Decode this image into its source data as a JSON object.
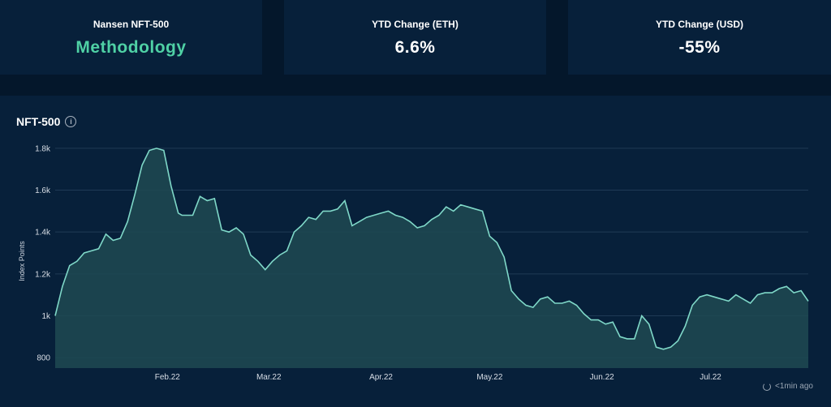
{
  "stats": [
    {
      "label": "Nansen NFT-500",
      "value": "Methodology"
    },
    {
      "label": "YTD Change (ETH)",
      "value": "6.6%"
    },
    {
      "label": "YTD Change (USD)",
      "value": "-55%"
    }
  ],
  "chart_title": "NFT-500",
  "updated": "<1min ago",
  "colors": {
    "line": "#7fd8c8",
    "fill": "#1e4a52",
    "grid": "#1f3a55"
  },
  "chart_data": {
    "type": "area",
    "title": "NFT-500",
    "xlabel": "",
    "ylabel": "Index Points",
    "ylim": [
      750,
      1850
    ],
    "yticks": [
      800,
      1000,
      1200,
      1400,
      1600,
      1800
    ],
    "ytick_labels": [
      "800",
      "1k",
      "1.2k",
      "1.4k",
      "1.6k",
      "1.8k"
    ],
    "xticks": [
      {
        "date": "2022-02-01",
        "label": "Feb.22"
      },
      {
        "date": "2022-03-01",
        "label": "Mar.22"
      },
      {
        "date": "2022-04-01",
        "label": "Apr.22"
      },
      {
        "date": "2022-05-01",
        "label": "May.22"
      },
      {
        "date": "2022-06-01",
        "label": "Jun.22"
      },
      {
        "date": "2022-07-01",
        "label": "Jul.22"
      }
    ],
    "x_range": [
      "2022-01-01",
      "2022-07-28"
    ],
    "grid": true,
    "series": [
      {
        "x": [
          "2022-01-01",
          "2022-01-03",
          "2022-01-05",
          "2022-01-07",
          "2022-01-09",
          "2022-01-11",
          "2022-01-13",
          "2022-01-15",
          "2022-01-17",
          "2022-01-19",
          "2022-01-21",
          "2022-01-23",
          "2022-01-25",
          "2022-01-27",
          "2022-01-29",
          "2022-01-31",
          "2022-02-02",
          "2022-02-04",
          "2022-02-05",
          "2022-02-07",
          "2022-02-08",
          "2022-02-10",
          "2022-02-12",
          "2022-02-14",
          "2022-02-16",
          "2022-02-18",
          "2022-02-20",
          "2022-02-22",
          "2022-02-24",
          "2022-02-26",
          "2022-02-28",
          "2022-03-02",
          "2022-03-04",
          "2022-03-06",
          "2022-03-08",
          "2022-03-10",
          "2022-03-12",
          "2022-03-14",
          "2022-03-16",
          "2022-03-18",
          "2022-03-20",
          "2022-03-22",
          "2022-03-24",
          "2022-03-26",
          "2022-03-28",
          "2022-03-30",
          "2022-04-01",
          "2022-04-03",
          "2022-04-05",
          "2022-04-07",
          "2022-04-09",
          "2022-04-11",
          "2022-04-13",
          "2022-04-15",
          "2022-04-17",
          "2022-04-19",
          "2022-04-21",
          "2022-04-23",
          "2022-04-25",
          "2022-04-27",
          "2022-04-29",
          "2022-05-01",
          "2022-05-03",
          "2022-05-05",
          "2022-05-07",
          "2022-05-09",
          "2022-05-11",
          "2022-05-13",
          "2022-05-15",
          "2022-05-17",
          "2022-05-19",
          "2022-05-21",
          "2022-05-23",
          "2022-05-25",
          "2022-05-27",
          "2022-05-29",
          "2022-05-31",
          "2022-06-02",
          "2022-06-04",
          "2022-06-06",
          "2022-06-08",
          "2022-06-10",
          "2022-06-12",
          "2022-06-14",
          "2022-06-16",
          "2022-06-18",
          "2022-06-20",
          "2022-06-22",
          "2022-06-24",
          "2022-06-26",
          "2022-06-28",
          "2022-06-30",
          "2022-07-02",
          "2022-07-04",
          "2022-07-06",
          "2022-07-08",
          "2022-07-10",
          "2022-07-12",
          "2022-07-14",
          "2022-07-16",
          "2022-07-18",
          "2022-07-20",
          "2022-07-22",
          "2022-07-24",
          "2022-07-26",
          "2022-07-28"
        ],
        "y": [
          1000,
          1140,
          1240,
          1260,
          1300,
          1310,
          1320,
          1390,
          1360,
          1370,
          1450,
          1580,
          1720,
          1790,
          1800,
          1790,
          1620,
          1490,
          1480,
          1480,
          1480,
          1570,
          1550,
          1560,
          1410,
          1400,
          1420,
          1390,
          1290,
          1260,
          1220,
          1260,
          1290,
          1310,
          1400,
          1430,
          1470,
          1460,
          1500,
          1500,
          1510,
          1550,
          1430,
          1450,
          1470,
          1480,
          1490,
          1500,
          1480,
          1470,
          1450,
          1420,
          1430,
          1460,
          1480,
          1520,
          1500,
          1530,
          1520,
          1510,
          1500,
          1380,
          1350,
          1280,
          1120,
          1080,
          1050,
          1040,
          1080,
          1090,
          1060,
          1060,
          1070,
          1050,
          1010,
          980,
          980,
          960,
          970,
          900,
          890,
          890,
          1000,
          960,
          850,
          840,
          850,
          880,
          950,
          1050,
          1090,
          1100,
          1090,
          1080,
          1070,
          1100,
          1080,
          1060,
          1100,
          1110,
          1110,
          1130,
          1140,
          1110,
          1120,
          1070
        ]
      }
    ]
  }
}
